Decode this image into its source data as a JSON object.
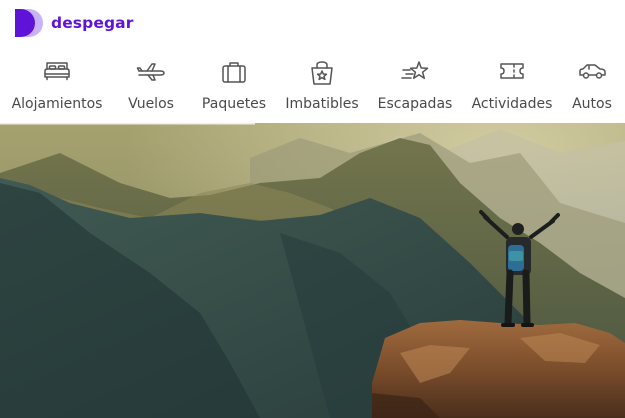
{
  "brand": {
    "name": "despegar",
    "color": "#5f13d9",
    "logo_light": "#c9b2f5"
  },
  "nav": {
    "items": [
      {
        "label": "Alojamientos",
        "icon": "bed-icon"
      },
      {
        "label": "Vuelos",
        "icon": "airplane-icon"
      },
      {
        "label": "Paquetes",
        "icon": "suitcase-icon"
      },
      {
        "label": "Imbatibles",
        "icon": "star-bag-icon"
      },
      {
        "label": "Escapadas",
        "icon": "shooting-star-icon"
      },
      {
        "label": "Actividades",
        "icon": "ticket-icon"
      },
      {
        "label": "Autos",
        "icon": "car-icon"
      }
    ]
  },
  "hero": {
    "image": "hiker-on-mountain-peak"
  },
  "colors": {
    "nav_text": "#4a4a4a",
    "icon_stroke": "#555555"
  }
}
